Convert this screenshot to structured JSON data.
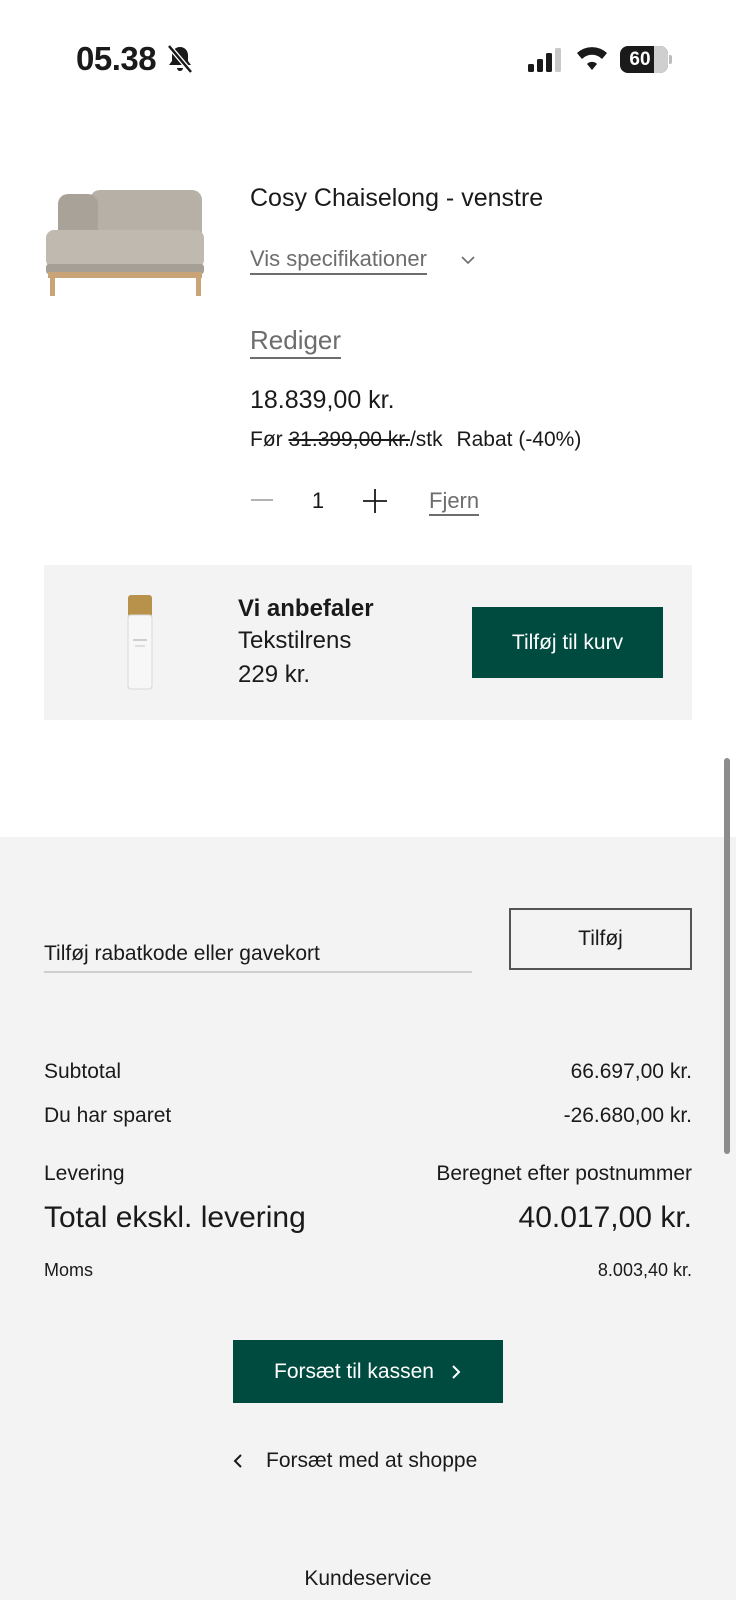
{
  "status_bar": {
    "time": "05.38",
    "battery": "60",
    "icons": [
      "bell-slash-icon",
      "cellular-signal-icon",
      "wifi-icon",
      "battery-icon"
    ]
  },
  "product": {
    "name": "Cosy Chaiselong - venstre",
    "specs_label": "Vis specifikationer",
    "edit_label": "Rediger",
    "price": "18.839,00 kr.",
    "before_label": "Før",
    "before_price": "31.399,00 kr.",
    "per_unit": "/stk",
    "discount": "Rabat (-40%)",
    "quantity": "1",
    "remove_label": "Fjern",
    "image": "sofa-chaiselong-image"
  },
  "recommendation": {
    "heading": "Vi anbefaler",
    "name": "Tekstilrens",
    "price": "229 kr.",
    "button_label": "Tilføj til kurv",
    "image": "spray-bottle-image"
  },
  "promo": {
    "placeholder": "Tilføj rabatkode eller gavekort",
    "button_label": "Tilføj"
  },
  "summary": {
    "subtotal_label": "Subtotal",
    "subtotal_value": "66.697,00 kr.",
    "saved_label": "Du har sparet",
    "saved_value": "-26.680,00 kr.",
    "delivery_label": "Levering",
    "delivery_value": "Beregnet efter postnummer",
    "total_label": "Total ekskl. levering",
    "total_value": "40.017,00 kr.",
    "vat_label": "Moms",
    "vat_value": "8.003,40 kr."
  },
  "actions": {
    "checkout_label": "Forsæt til kassen",
    "continue_label": "Forsæt med at shoppe"
  },
  "footer": {
    "customer_service": "Kundeservice"
  },
  "colors": {
    "brand_green": "#004b3f",
    "panel_grey": "#f3f3f3",
    "muted_text": "#6d6d6d"
  }
}
